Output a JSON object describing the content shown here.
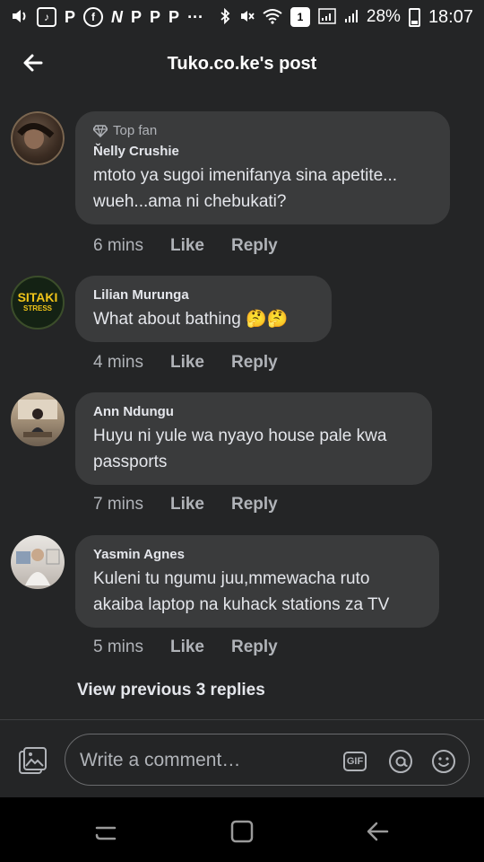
{
  "status_bar": {
    "battery": "28%",
    "time": "18:07",
    "sim_badge": "1",
    "app_icons": [
      "volume-icon",
      "tiktok-icon",
      "pinterest-icon",
      "facebook-icon",
      "nation-icon",
      "pinterest-icon",
      "pinterest-icon",
      "pinterest-icon"
    ]
  },
  "header": {
    "title": "Tuko.co.ke's post"
  },
  "comments": [
    {
      "badge": "Top fan",
      "author": "Ňelly Crushie",
      "text": "mtoto ya sugoi imenifanya sina apetite... wueh...ama ni chebukati?",
      "time": "6 mins",
      "like": "Like",
      "reply": "Reply"
    },
    {
      "author": "Lilian Murunga",
      "text": "What about bathing 🤔🤔",
      "time": "4 mins",
      "like": "Like",
      "reply": "Reply",
      "avatar_text_top": "SITAKI",
      "avatar_text_bottom": "STRESS"
    },
    {
      "author": "Ann Ndungu",
      "text": "Huyu ni yule wa nyayo house pale kwa passports",
      "time": "7 mins",
      "like": "Like",
      "reply": "Reply"
    },
    {
      "author": "Yasmin Agnes",
      "text": "Kuleni tu ngumu juu,mmewacha ruto akaiba laptop na kuhack stations za TV",
      "time": "5 mins",
      "like": "Like",
      "reply": "Reply"
    }
  ],
  "view_previous": "View previous 3 replies",
  "composer": {
    "placeholder": "Write a comment…",
    "gif_label": "GIF"
  },
  "colors": {
    "background": "#242526",
    "bubble": "#3a3b3c",
    "primary_text": "#e4e6eb",
    "secondary_text": "#b0b3b8"
  }
}
